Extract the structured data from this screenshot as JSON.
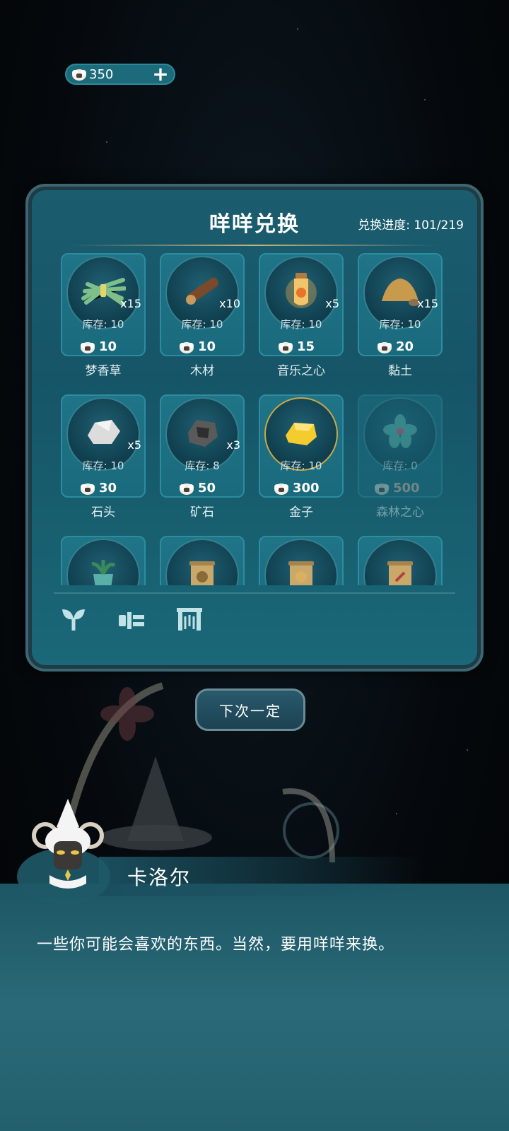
{
  "currency": {
    "amount": "350",
    "plus_icon": "plus-icon",
    "icon": "sheep-coin-icon"
  },
  "panel": {
    "title": "咩咩兑换",
    "progress_label": "兑换进度: 101/219"
  },
  "items": [
    {
      "name": "梦香草",
      "qty": "x15",
      "stock": "库存: 10",
      "price": "10",
      "icon": "grass-bundle-icon"
    },
    {
      "name": "木材",
      "qty": "x10",
      "stock": "库存: 10",
      "price": "10",
      "icon": "wood-log-icon"
    },
    {
      "name": "音乐之心",
      "qty": "x5",
      "stock": "库存: 10",
      "price": "15",
      "icon": "music-heart-bottle-icon"
    },
    {
      "name": "黏土",
      "qty": "x15",
      "stock": "库存: 10",
      "price": "20",
      "icon": "clay-pile-icon"
    },
    {
      "name": "石头",
      "qty": "x5",
      "stock": "库存: 10",
      "price": "30",
      "icon": "stone-icon"
    },
    {
      "name": "矿石",
      "qty": "x3",
      "stock": "库存: 8",
      "price": "50",
      "icon": "ore-icon"
    },
    {
      "name": "金子",
      "qty": "",
      "stock": "库存: 10",
      "price": "300",
      "icon": "gold-nugget-icon"
    },
    {
      "name": "森林之心",
      "qty": "",
      "stock": "库存: 0",
      "price": "500",
      "icon": "forest-heart-icon"
    }
  ],
  "tabs": [
    {
      "icon": "sprout-icon"
    },
    {
      "icon": "tools-icon"
    },
    {
      "icon": "decor-icon"
    }
  ],
  "action_button": {
    "label": "下次一定"
  },
  "dialog": {
    "npc_name": "卡洛尔",
    "text": "一些你可能会喜欢的东西。当然，要用咩咩来换。"
  }
}
